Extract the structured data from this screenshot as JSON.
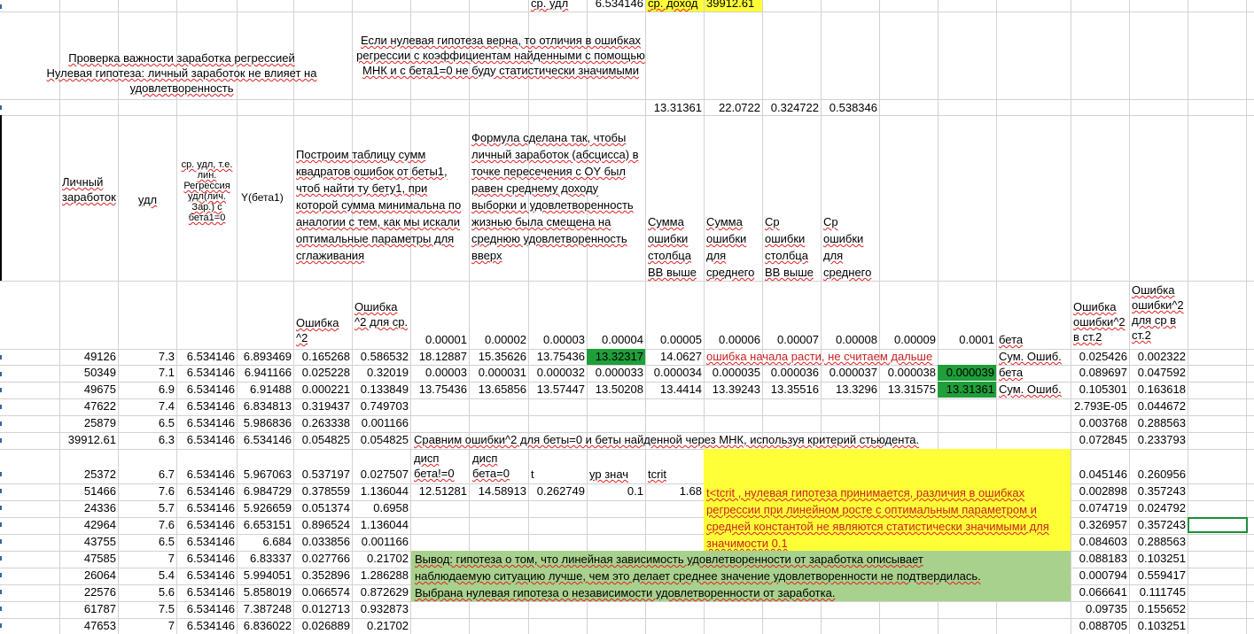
{
  "top": {
    "label_avg_udl": "ср. удл",
    "avg_udl_value": "6.534146",
    "label_avg_income": "ср. доход",
    "avg_income_value": "39912.61"
  },
  "notes": {
    "title_left_l1": "Проверка важности заработка регрессией",
    "title_left_l2": "Нулевая гипотеза: личный заработок не влияет на удовлетворенность",
    "note_mid": "Если нулевая гипотеза верна, то отличия в ошибках регрессии с коэффициентам найденными с помощью МНК и с бета1=0 не буду статистически значимыми"
  },
  "summary_row": [
    "13.31361",
    "22.0722",
    "0.324722",
    "0.538346"
  ],
  "headers": {
    "income": "Личный заработок",
    "udl": "удл",
    "regr": "ср. удл, т.е. лин. Регрессия удл(лич. Зар.) с бета1=0",
    "ybeta": "Y(бета1)",
    "table_note": "Построим таблицу сумм квадратов ошибок от беты1, чтоб найти ту бету1, при которой сумма минимальна по аналогии с тем, как мы искали оптимальные параметры для сглаживания",
    "formula_note": "Формула сделана так, чтобы личный заработок (абсцисса) в точке пересечения с OY был равен среднему доходу выборки и удовлетворенность жизнью была смещена на среднюю удовлетворенность вверх",
    "sum_err_col": "Сумма ошибки столбца ВВ выше",
    "sum_err_avg": "Сумма ошибки для среднего",
    "avg_err_col": "Ср ошибки столбца ВВ выше",
    "avg_err_avg": "Ср ошибки для среднего",
    "err2": "Ошибка ^2",
    "err2_avg": "Ошибка ^2 для ср.",
    "beta_label": "бета",
    "err2_st2": "Ошибка ошибки^2 в ст.2",
    "err2_avg_st2": "Ошибка ошибки^2 для ср в ст.2"
  },
  "betas": [
    "0.00001",
    "0.00002",
    "0.00003",
    "0.00004",
    "0.00005",
    "0.00006",
    "0.00007",
    "0.00008",
    "0.00009",
    "0.0001"
  ],
  "beta_row1": [
    "18.12887",
    "15.35626",
    "13.75436",
    "13.32317",
    "14.0627"
  ],
  "beta_row1_note": "ошибка начала расти, не считаем дальше",
  "beta_row2": [
    "0.00003",
    "0.000031",
    "0.000032",
    "0.000033",
    "0.000034",
    "0.000035",
    "0.000036",
    "0.000037",
    "0.000038",
    "0.000039"
  ],
  "beta_row3": [
    "13.75436",
    "13.65856",
    "13.57447",
    "13.50208",
    "13.4414",
    "13.39243",
    "13.35516",
    "13.3296",
    "13.31575",
    "13.31361"
  ],
  "side_labels": [
    "Сум. Ошиб.",
    "бета",
    "Сум. Ошиб."
  ],
  "compare_text": "Сравним ошибки^2 для беты=0 и беты найденной через МНК, используя критерий стьюдента.",
  "ttest": {
    "h1": "дисп бета!=0",
    "h2": "дисп бета=0",
    "h3": "t",
    "h4": "ур знач",
    "h5": "tcrit",
    "v1": "12.51281",
    "v2": "14.58913",
    "v3": "0.262749",
    "v4": "0.1",
    "v5": "1.68"
  },
  "yellow_note": "t<tcrit , нулевая гипотеза принимается, различия в ошибках регрессии при линейном росте с оптимальным параметром и средней константой не являются статистически значимыми для значимости 0.1",
  "conclusion": [
    "Вывод: гипотеза о том, что линейная зависимость удовлетворенности от заработка описывает",
    "наблюдаемую ситуацию лучше, чем это делает среднее значение удовлетворенности не подтвердилась.",
    "Выбрана нулевая гипотеза о независимости удовлетворенности от заработка."
  ],
  "rows": [
    {
      "inc": "49126",
      "udl": "7.3",
      "reg": "6.534146",
      "yb": "6.893469",
      "e2": "0.165268",
      "e2a": "0.586532",
      "st2": "0.025426",
      "st2a": "0.002322"
    },
    {
      "inc": "50349",
      "udl": "7.1",
      "reg": "6.534146",
      "yb": "6.941166",
      "e2": "0.025228",
      "e2a": "0.32019",
      "st2": "0.089697",
      "st2a": "0.047592"
    },
    {
      "inc": "49675",
      "udl": "6.9",
      "reg": "6.534146",
      "yb": "6.91488",
      "e2": "0.000221",
      "e2a": "0.133849",
      "st2": "0.105301",
      "st2a": "0.163618"
    },
    {
      "inc": "47622",
      "udl": "7.4",
      "reg": "6.534146",
      "yb": "6.834813",
      "e2": "0.319437",
      "e2a": "0.749703",
      "st2": "2.793E-05",
      "st2a": "0.044672"
    },
    {
      "inc": "25879",
      "udl": "6.5",
      "reg": "6.534146",
      "yb": "5.986836",
      "e2": "0.263338",
      "e2a": "0.001166",
      "st2": "0.003768",
      "st2a": "0.288563"
    },
    {
      "inc": "39912.61",
      "udl": "6.3",
      "reg": "6.534146",
      "yb": "6.534146",
      "e2": "0.054825",
      "e2a": "0.054825",
      "st2": "0.072845",
      "st2a": "0.233793"
    },
    {
      "inc": "25372",
      "udl": "6.7",
      "reg": "6.534146",
      "yb": "5.967063",
      "e2": "0.537197",
      "e2a": "0.027507",
      "st2": "0.045146",
      "st2a": "0.260956"
    },
    {
      "inc": "51466",
      "udl": "7.6",
      "reg": "6.534146",
      "yb": "6.984729",
      "e2": "0.378559",
      "e2a": "1.136044",
      "st2": "0.002898",
      "st2a": "0.357243"
    },
    {
      "inc": "24336",
      "udl": "5.7",
      "reg": "6.534146",
      "yb": "5.926659",
      "e2": "0.051374",
      "e2a": "0.6958",
      "st2": "0.074719",
      "st2a": "0.024792"
    },
    {
      "inc": "42964",
      "udl": "7.6",
      "reg": "6.534146",
      "yb": "6.653151",
      "e2": "0.896524",
      "e2a": "1.136044",
      "st2": "0.326957",
      "st2a": "0.357243"
    },
    {
      "inc": "43755",
      "udl": "6.5",
      "reg": "6.534146",
      "yb": "6.684",
      "e2": "0.033856",
      "e2a": "0.001166",
      "st2": "0.084603",
      "st2a": "0.288563"
    },
    {
      "inc": "47585",
      "udl": "7",
      "reg": "6.534146",
      "yb": "6.83337",
      "e2": "0.027766",
      "e2a": "0.21702",
      "st2": "0.088183",
      "st2a": "0.103251"
    },
    {
      "inc": "26064",
      "udl": "5.4",
      "reg": "6.534146",
      "yb": "5.994051",
      "e2": "0.352896",
      "e2a": "1.286288",
      "st2": "0.000794",
      "st2a": "0.559417"
    },
    {
      "inc": "22576",
      "udl": "5.6",
      "reg": "6.534146",
      "yb": "5.858019",
      "e2": "0.066574",
      "e2a": "0.872629",
      "st2": "0.066641",
      "st2a": "0.111745"
    },
    {
      "inc": "61787",
      "udl": "7.5",
      "reg": "6.534146",
      "yb": "7.387248",
      "e2": "0.012713",
      "e2a": "0.932873",
      "st2": "0.09735",
      "st2a": "0.155652"
    },
    {
      "inc": "47653",
      "udl": "7",
      "reg": "6.534146",
      "yb": "6.836022",
      "e2": "0.026889",
      "e2a": "0.21702",
      "st2": "0.088705",
      "st2a": "0.103251"
    }
  ],
  "colors": {
    "yellow": "#ffff38",
    "green": "#1f9e3a",
    "light_green": "#a9d18e",
    "grid": "#d2d2d2",
    "red_text": "#c9211e"
  }
}
